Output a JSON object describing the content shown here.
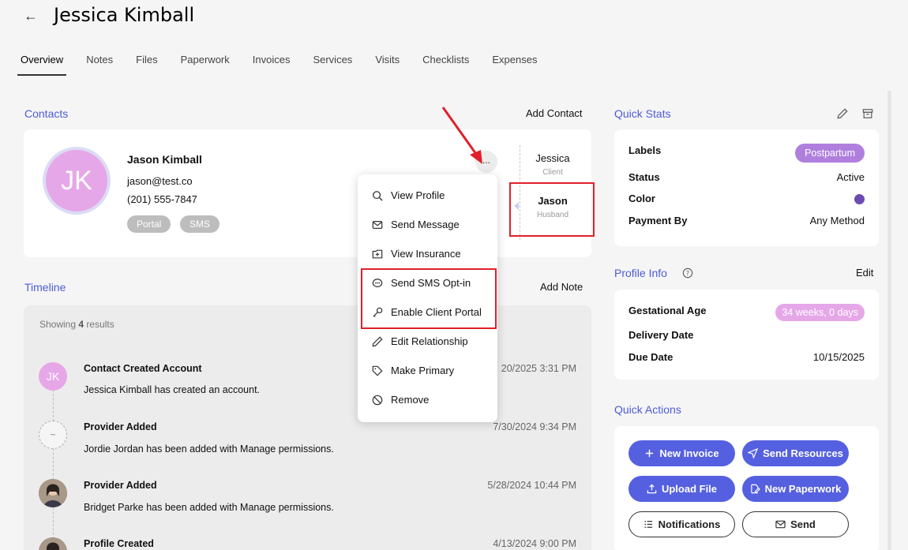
{
  "header": {
    "back_icon": "←",
    "title": "Jessica Kimball"
  },
  "tabs": [
    "Overview",
    "Notes",
    "Files",
    "Paperwork",
    "Invoices",
    "Services",
    "Visits",
    "Checklists",
    "Expenses"
  ],
  "contacts": {
    "title": "Contacts",
    "add_label": "Add Contact",
    "contact": {
      "initials": "JK",
      "name": "Jason Kimball",
      "email": "jason@test.co",
      "phone": "(201) 555-7847",
      "tags": [
        "Portal",
        "SMS"
      ],
      "more_label": "..."
    },
    "relations": [
      {
        "name": "Jessica",
        "role": "Client"
      },
      {
        "name": "Jason",
        "role": "Husband"
      }
    ]
  },
  "menu": {
    "items": [
      {
        "label": "View Profile",
        "icon": "search-icon"
      },
      {
        "label": "Send Message",
        "icon": "mail-icon"
      },
      {
        "label": "View Insurance",
        "icon": "insurance-icon"
      },
      {
        "label": "Send SMS Opt-in",
        "icon": "sms-icon"
      },
      {
        "label": "Enable Client Portal",
        "icon": "key-icon"
      },
      {
        "label": "Edit Relationship",
        "icon": "pencil-icon"
      },
      {
        "label": "Make Primary",
        "icon": "tag-icon"
      },
      {
        "label": "Remove",
        "icon": "ban-icon"
      }
    ]
  },
  "timeline": {
    "title": "Timeline",
    "add_label": "Add Note",
    "showing_prefix": "Showing",
    "showing_count": "4",
    "showing_suffix": "results",
    "events": [
      {
        "avatar": "JK",
        "title": "Contact Created Account",
        "desc": "Jessica Kimball has created an account.",
        "date": "20/2025 3:31 PM"
      },
      {
        "avatar": "~",
        "title": "Provider Added",
        "desc": "Jordie Jordan has been added with Manage permissions.",
        "date": "7/30/2024 9:34 PM"
      },
      {
        "avatar": "",
        "title": "Provider Added",
        "desc": "Bridget Parke has been added with Manage permissions.",
        "date": "5/28/2024 10:44 PM"
      },
      {
        "avatar": "",
        "title": "Profile Created",
        "desc": "",
        "date": "4/13/2024 9:00 PM"
      }
    ]
  },
  "quick_stats": {
    "title": "Quick Stats",
    "labels_label": "Labels",
    "labels_value": "Postpartum",
    "status_label": "Status",
    "status_value": "Active",
    "color_label": "Color",
    "color_value": "#6e4bb0",
    "payment_label": "Payment By",
    "payment_value": "Any Method"
  },
  "profile_info": {
    "title": "Profile Info",
    "edit_label": "Edit",
    "gest_label": "Gestational Age",
    "gest_value": "34 weeks, 0 days",
    "delivery_label": "Delivery Date",
    "due_label": "Due Date",
    "due_value": "10/15/2025"
  },
  "quick_actions": {
    "title": "Quick Actions",
    "buttons": [
      "New Invoice",
      "Send Resources",
      "Upload File",
      "New Paperwork",
      "Notifications",
      "Send"
    ]
  },
  "colors": {
    "accent": "#4d5bd9",
    "button": "#5560e0",
    "highlight": "#e0202a",
    "avatar": "#e6a7e8"
  }
}
